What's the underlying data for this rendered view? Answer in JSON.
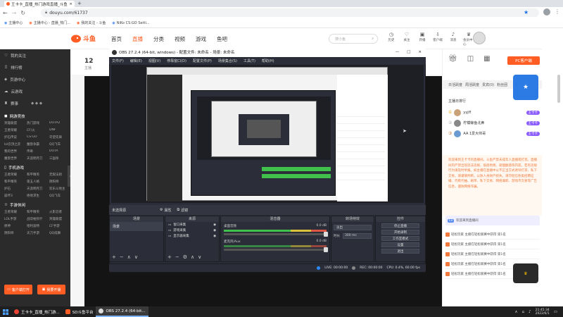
{
  "browser": {
    "tab_title": "王卡卡_直播_热门游戏直播_斗鱼",
    "url": "douyu.com/61737",
    "bookmarks": [
      "主播中心",
      "主播中心 - 直播_热门...",
      "我的关注 - 斗鱼",
      "NiKo CS:GO Setti..."
    ]
  },
  "site": {
    "logo_text": "斗鱼",
    "nav": [
      "首页",
      "直播",
      "分类",
      "视频",
      "游戏",
      "鱼吧"
    ],
    "search_placeholder": "搜小鱼",
    "header_icons": [
      "历史",
      "关注",
      "开播",
      "客户端",
      "消息",
      "会员中心"
    ]
  },
  "sidebar": {
    "items": [
      "我的关注",
      "排行榜",
      "页游中心",
      "云游戏",
      "赛事"
    ],
    "section_online": "网游竞技",
    "online_games": [
      "英雄联盟",
      "热门游戏",
      "DOTA2",
      "王者荣耀",
      "CF/火",
      "DNF",
      "炉石传说",
      "CS:GO",
      "守望先锋",
      "lol云顶之弈",
      "魔兽争霸",
      "QQ飞车",
      "我的世界",
      "传奇",
      "DOTA",
      "魔兽世界",
      "天涯明月刀",
      "三国杀"
    ],
    "section_mobile": "手机游戏",
    "mobile_games": [
      "王者荣耀",
      "和平精英",
      "无限法则",
      "和平精英",
      "第五人格",
      "阴阳师",
      "炉石",
      "天涯明月刀",
      "欢乐斗地主",
      "崩坏3",
      "绝地求生",
      "QQ飞车"
    ],
    "section_ent": "手游休闲",
    "ent_games": [
      "王者荣耀",
      "和平精英",
      "火影忍者",
      "LOL手游",
      "战双帕弥什",
      "英雄联盟",
      "原神",
      "哈利波特",
      "CF手游",
      "阴阳师",
      "天刀手游",
      "QQ炫舞"
    ],
    "btn_client": "客户端打开",
    "btn_live": "我要开播"
  },
  "room": {
    "count": "12",
    "name": "主播",
    "fans_label": "粉丝"
  },
  "obs": {
    "title": "OBS 27.2.4 (64-bit, windows) - 配置文件: 未命名 - 场景: 未命名",
    "menu": [
      "文件(F)",
      "编辑(E)",
      "视图(V)",
      "停靠窗口(D)",
      "配置文件(P)",
      "场景集合(S)",
      "工具(T)",
      "帮助(H)"
    ],
    "no_source": "未选择源",
    "props_label": "属性",
    "filters_label": "滤镜",
    "docks": {
      "scenes": {
        "header": "场景",
        "items": [
          "场景"
        ]
      },
      "sources": {
        "header": "来源",
        "items": [
          "窗口采集",
          "游戏采集",
          "显示器采集"
        ]
      },
      "mixer": {
        "header": "混音器",
        "channels": [
          "桌面音频",
          "麦克风/Aux"
        ],
        "db": "0.0 dB"
      },
      "transitions": {
        "header": "转场特效",
        "type": "淡出",
        "duration_label": "时长",
        "duration": "300 ms"
      },
      "controls": {
        "header": "控件",
        "buttons": [
          "停止直播",
          "开始录制",
          "工作室模式",
          "设置",
          "退出"
        ]
      }
    },
    "status": [
      "LIVE: 00:00:00",
      "REC: 00:00:00",
      "CPU: 0.4%, 60.00 fps"
    ]
  },
  "right_panel": {
    "pc_client": "PC客户端",
    "tabs": [
      "日活跃度",
      "周活跃度",
      "贵宾(0)",
      "粉丝团"
    ],
    "rank_title": "主播日排行",
    "users": [
      {
        "name": "yyjff",
        "badge": "王卡卡"
      },
      {
        "name": "柠檬鲸鱼北鼻",
        "badge": "王卡卡"
      },
      {
        "name": "AA 1爱大帅哥",
        "badge": "王卡卡"
      }
    ],
    "notice": "欢迎来到王卡卡的直播间。斗鱼严禁未成年人直播或打赏。直播间内严禁出现违法违规、低俗色情、吸烟酗酒等内容，若有违规行为请及时举报。如主播在直播中以不正当方式诱导打赏、私下交易，请谨慎判断，以防人身财产损失。请勿轻信各类招聘征婚、代练代抽、刷单、私下交易、网络兼职、游戏币交易等广告信息，谨防网络诈骗。",
    "welcome": "欢迎来到直播间",
    "chat": [
      "轻松玩家 主播在轻松联赛中获得 第1名",
      "轻松玩家 主播在轻松联赛中获得 第1名",
      "轻松玩家 主播在轻松联赛中获得 第1名",
      "轻松玩家 主播在轻松联赛中获得 第1名",
      "轻松玩家 主播在轻松联赛中获得 第1名"
    ]
  },
  "taskbar": {
    "items": [
      "王卡卡_直播_热门游...",
      "SD斗鱼平台",
      "OBS 27.2.4 (64-bit..."
    ],
    "time": "21:45:34",
    "date": "2022/6/1"
  },
  "colors": {
    "accent": "#ff5d23",
    "sidebar_bg": "#2b2b2b",
    "obs_bg": "#2b2e38",
    "meter_green": "#3fc14b"
  }
}
